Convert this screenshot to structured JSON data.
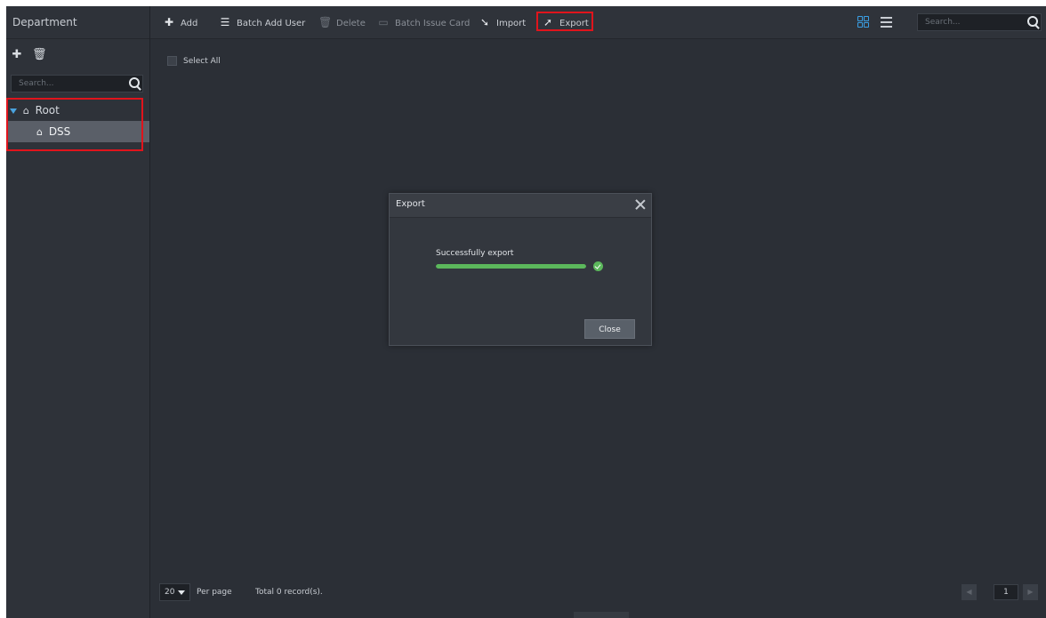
{
  "sidebar": {
    "title": "Department",
    "search_placeholder": "Search...",
    "tree": {
      "root_label": "Root",
      "child_label": "DSS"
    }
  },
  "toolbar": {
    "add": "Add",
    "batch_add_user": "Batch Add User",
    "delete": "Delete",
    "batch_issue_card": "Batch Issue Card",
    "import": "Import",
    "export": "Export",
    "search_placeholder": "Search..."
  },
  "content": {
    "select_all": "Select All"
  },
  "footer": {
    "per_page_value": "20",
    "per_page_label": "Per page",
    "total": "Total 0 record(s).",
    "current_page": "1"
  },
  "dialog": {
    "title": "Export",
    "status": "Successfully export",
    "progress_percent": 100,
    "close_label": "Close"
  },
  "colors": {
    "accent": "#3aa0e6",
    "success": "#5cb85c",
    "highlight_box": "#e0141c"
  }
}
